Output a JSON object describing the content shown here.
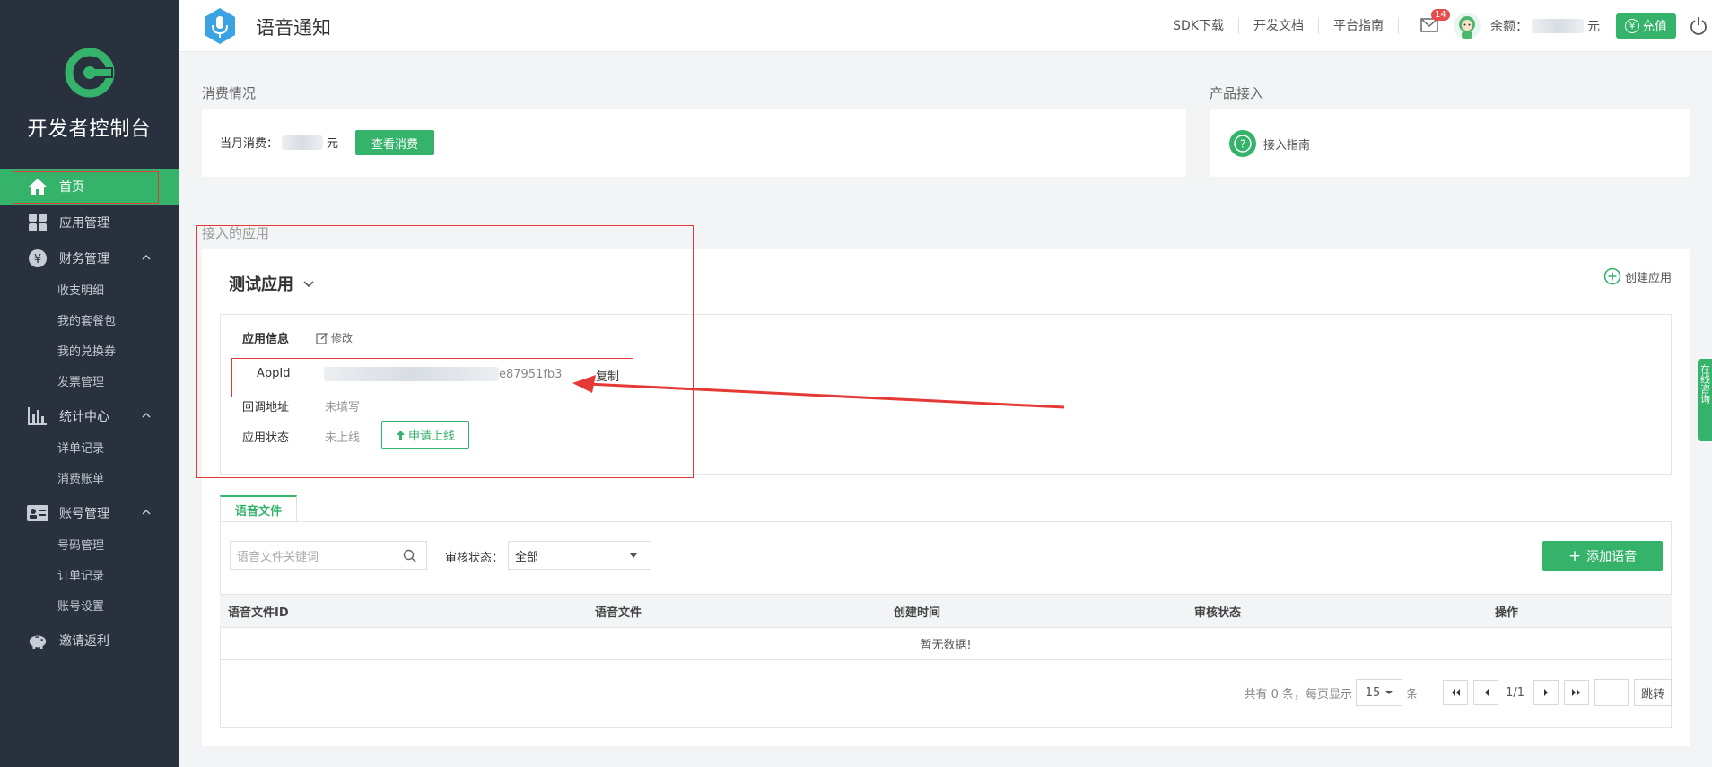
{
  "sidebar": {
    "brand": "开发者控制台",
    "items": [
      {
        "label": "首页",
        "icon": "home-icon",
        "active": true
      },
      {
        "label": "应用管理",
        "icon": "grid-icon"
      },
      {
        "label": "财务管理",
        "icon": "yen-icon",
        "sub": [
          "收支明细",
          "我的套餐包",
          "我的兑换券",
          "发票管理"
        ]
      },
      {
        "label": "统计中心",
        "icon": "bar-chart-icon",
        "sub": [
          "详单记录",
          "消费账单"
        ]
      },
      {
        "label": "账号管理",
        "icon": "id-card-icon",
        "sub": [
          "号码管理",
          "订单记录",
          "账号设置"
        ]
      },
      {
        "label": "邀请返利",
        "icon": "piggy-bank-icon"
      }
    ]
  },
  "topbar": {
    "title": "语音通知",
    "links": [
      "SDK下载",
      "开发文档",
      "平台指南"
    ],
    "mail_badge": "14",
    "balance_label": "余额：",
    "balance_unit": "元",
    "recharge": "充值",
    "recharge_symbol": "¥"
  },
  "consumption": {
    "title": "消费情况",
    "monthly_label": "当月消费：",
    "unit": "元",
    "view_button": "查看消费"
  },
  "product": {
    "title": "产品接入",
    "guide": "接入指南"
  },
  "apps": {
    "title": "接入的应用",
    "current_app": "测试应用",
    "create": "创建应用",
    "info_label": "应用信息",
    "edit": "修改",
    "appid_label": "AppId",
    "appid_value_visible": "e87951fb3",
    "copy": "复制",
    "callback_label": "回调地址",
    "callback_value": "未填写",
    "status_label": "应用状态",
    "status_value": "未上线",
    "apply_online": "申请上线"
  },
  "voice_files": {
    "tab": "语音文件",
    "search_placeholder": "语音文件关键词",
    "audit_label": "审核状态：",
    "audit_value": "全部",
    "add_button": "添加语音",
    "columns": [
      "语音文件ID",
      "语音文件",
      "创建时间",
      "审核状态",
      "操作"
    ],
    "empty": "暂无数据!",
    "pager": {
      "total_text": "共有 0 条，每页显示",
      "page_size": "15",
      "unit": "条",
      "page": "1/1",
      "jump": "跳转"
    }
  },
  "side_tab": "在线咨询",
  "colors": {
    "accent": "#35b36b",
    "sidebar": "#28313d",
    "annotation": "#e53935"
  }
}
